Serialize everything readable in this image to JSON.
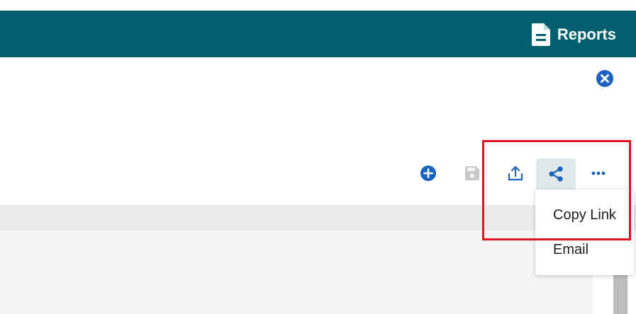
{
  "header": {
    "title": "Reports",
    "icon": "document-icon",
    "background": "#025f6e"
  },
  "toolbar": {
    "items": [
      {
        "name": "add",
        "icon": "plus-circle-icon",
        "state": "enabled"
      },
      {
        "name": "save",
        "icon": "save-icon",
        "state": "disabled"
      },
      {
        "name": "export",
        "icon": "upload-icon",
        "state": "enabled"
      },
      {
        "name": "share",
        "icon": "share-icon",
        "state": "active"
      },
      {
        "name": "more",
        "icon": "more-horizontal-icon",
        "state": "enabled"
      }
    ],
    "accent": "#1b63bf"
  },
  "share_menu": {
    "items": [
      {
        "label": "Copy Link"
      },
      {
        "label": "Email"
      }
    ]
  },
  "colors": {
    "highlight": "#e0141e",
    "close": "#1b63bf"
  }
}
